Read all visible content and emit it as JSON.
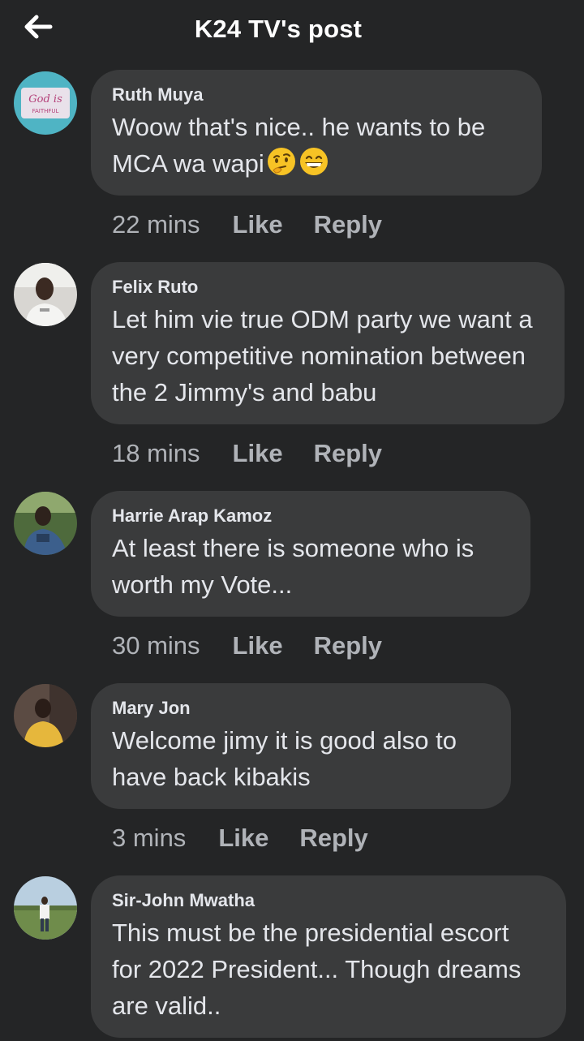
{
  "header": {
    "title": "K24 TV's post",
    "back_icon": "arrow-left-icon"
  },
  "comments": [
    {
      "author": "Ruth Muya",
      "text": "Woow that's nice.. he wants to be MCA wa wapi",
      "emojis": [
        "thinking-face-icon",
        "grinning-face-icon"
      ],
      "time": "22 mins",
      "like": "Like",
      "reply": "Reply",
      "avatar_text_1": "God is",
      "avatar_text_2": "FAITHFUL"
    },
    {
      "author": "Felix Ruto",
      "text": "Let him vie true ODM party we want a very competitive nomination between the 2 Jimmy's and babu",
      "time": "18 mins",
      "like": "Like",
      "reply": "Reply"
    },
    {
      "author": "Harrie Arap Kamoz",
      "text": "At least there is someone who is worth my Vote...",
      "time": "30 mins",
      "like": "Like",
      "reply": "Reply"
    },
    {
      "author": "Mary Jon",
      "text": "Welcome jimy it is good also to have back kibakis",
      "time": "3 mins",
      "like": "Like",
      "reply": "Reply"
    },
    {
      "author": "Sir-John Mwatha",
      "text": "This must be the presidential escort for 2022 President... Though dreams are valid..",
      "time": "",
      "like": "",
      "reply": ""
    }
  ],
  "colors": {
    "background": "#242526",
    "bubble": "#3a3b3c",
    "text": "#e4e6eb",
    "secondary": "#b0b3b8"
  }
}
